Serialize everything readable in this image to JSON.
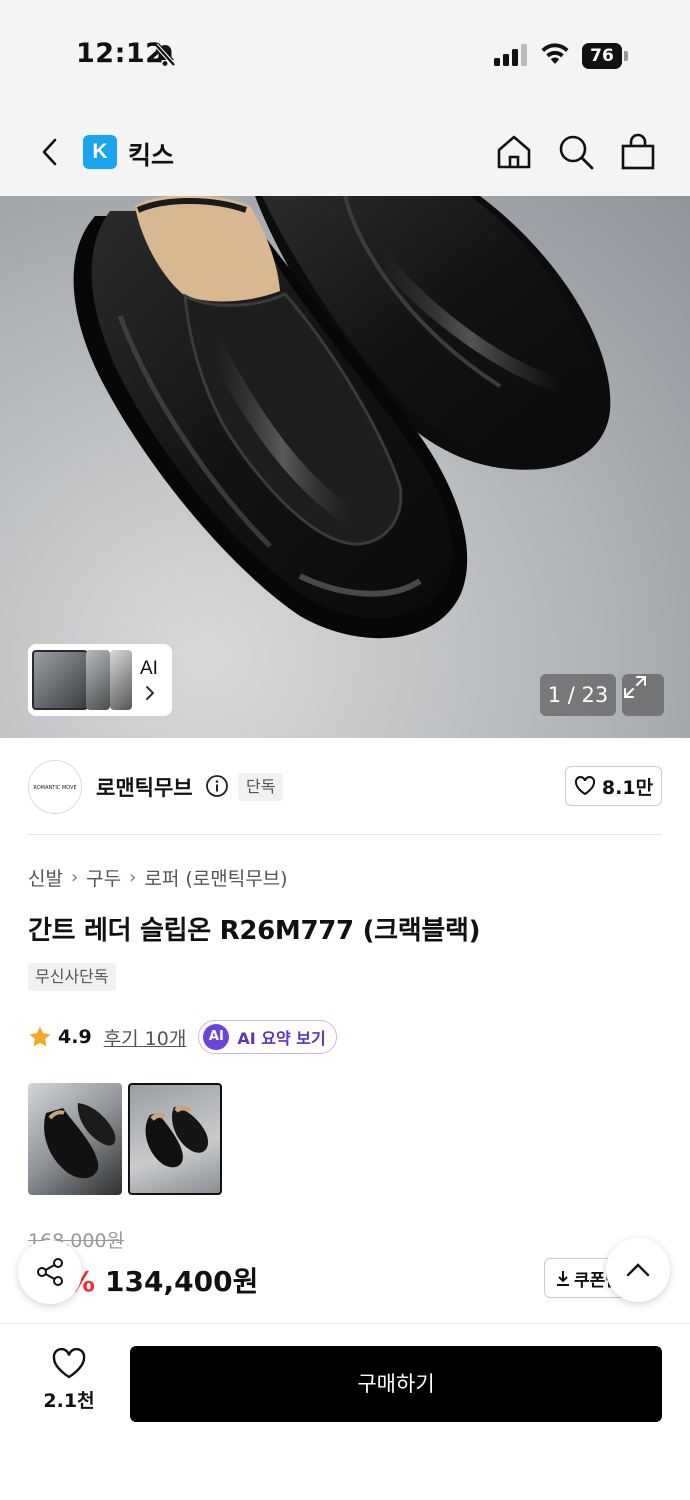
{
  "status_bar": {
    "time": "12:12",
    "battery": "76",
    "icons": [
      "bell-slash-icon",
      "signal-icon",
      "wifi-icon",
      "battery-icon"
    ]
  },
  "header": {
    "store_logo_letter": "K",
    "store_name": "킥스",
    "icons": [
      "back-icon",
      "home-icon",
      "search-icon",
      "bag-icon"
    ]
  },
  "hero": {
    "image_counter": "1 / 23",
    "thumb_ai_label": "AI",
    "icons": [
      "expand-icon",
      "chevron-right-icon"
    ]
  },
  "brand": {
    "name": "로맨틱무브",
    "logo_text": "ROMANTIC MOVE",
    "exclusive_badge": "단독",
    "likes": "8.1만"
  },
  "product": {
    "breadcrumb": [
      "신발",
      "구두",
      "로퍼 (로맨틱무브)"
    ],
    "title": "간트 레더 슬립온 R26M777 (크랙블랙)",
    "tag": "무신사단독",
    "rating": "4.9",
    "review_link": "후기 10개",
    "ai_badge": "AI",
    "ai_summary": "AI 요약 보기",
    "original_price": "168,000원",
    "discount": "20%",
    "price": "134,400원",
    "coupon": "쿠폰받기"
  },
  "bottom_bar": {
    "wish_count": "2.1천",
    "buy_label": "구매하기"
  },
  "colors": {
    "accent_purple": "#6b45d8",
    "discount_red": "#ee3030",
    "store_logo_blue": "#1aa5f0",
    "buy_button": "#000000"
  }
}
